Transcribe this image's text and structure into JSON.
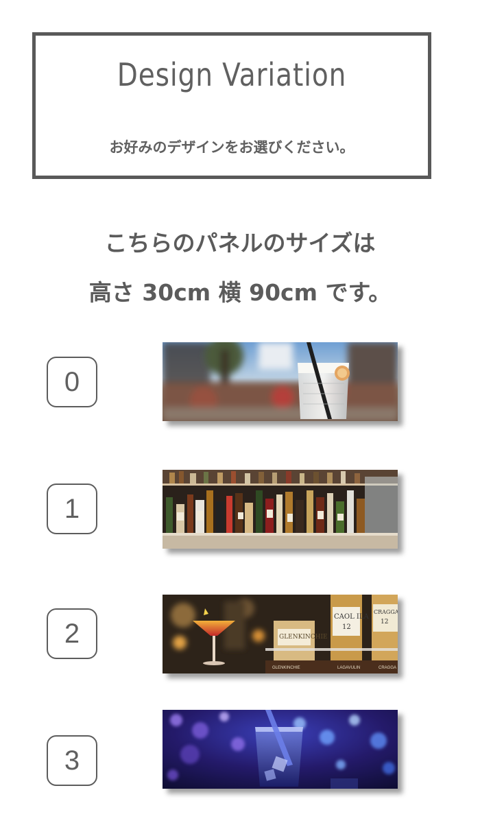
{
  "header": {
    "title": "Design Variation",
    "subtitle": "お好みのデザインをお選びください。"
  },
  "size_info": {
    "line1": "こちらのパネルのサイズは",
    "line2": "高さ 30cm 横 90cm です。"
  },
  "designs": [
    {
      "number": "0",
      "image": "cocktail-glass-outdoor-photo"
    },
    {
      "number": "1",
      "image": "bar-liquor-shelf-photo"
    },
    {
      "number": "2",
      "image": "cocktail-and-whisky-bottles-photo"
    },
    {
      "number": "3",
      "image": "blue-drink-bokeh-photo"
    }
  ],
  "panel2_labels": {
    "bottle_left": "GLENKINCHIE",
    "bottle_mid": "CAOL ILA",
    "bottle_mid_age": "12",
    "bottle_right": "CRAGGAN",
    "bottle_right_age": "12",
    "shelf_left": "GLENKINCHIE",
    "shelf_mid": "LAGAVULIN",
    "shelf_right": "CRAGGA"
  }
}
